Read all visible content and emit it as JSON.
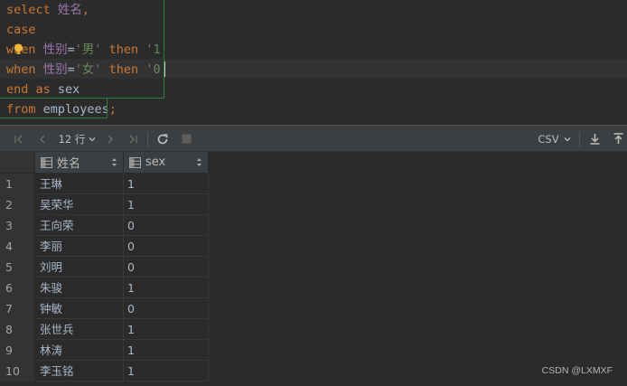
{
  "editor": {
    "lines": [
      [
        {
          "t": "select ",
          "c": "kw"
        },
        {
          "t": "姓名",
          "c": "col"
        },
        {
          "t": ",",
          "c": "kw"
        }
      ],
      [
        {
          "t": "case",
          "c": "kw"
        }
      ],
      [
        {
          "t": "when ",
          "c": "kw"
        },
        {
          "t": "性别",
          "c": "col"
        },
        {
          "t": "=",
          "c": "plain"
        },
        {
          "t": "'男'",
          "c": "str"
        },
        {
          "t": " then ",
          "c": "kw"
        },
        {
          "t": "'1'",
          "c": "str"
        }
      ],
      [
        {
          "t": "when ",
          "c": "kw"
        },
        {
          "t": "性别",
          "c": "col"
        },
        {
          "t": "=",
          "c": "plain"
        },
        {
          "t": "'女'",
          "c": "str"
        },
        {
          "t": " then ",
          "c": "kw"
        },
        {
          "t": "'0'",
          "c": "str"
        }
      ],
      [
        {
          "t": "end as ",
          "c": "kw"
        },
        {
          "t": "sex",
          "c": "plain"
        }
      ],
      [
        {
          "t": "from ",
          "c": "kw"
        },
        {
          "t": "employees",
          "c": "plain"
        },
        {
          "t": ";",
          "c": "kw"
        }
      ]
    ]
  },
  "toolbar": {
    "row_count": "12 行",
    "format": "CSV"
  },
  "grid": {
    "columns": [
      "姓名",
      "sex"
    ],
    "rows": [
      {
        "n": "1",
        "name": "王琳",
        "sex": "1"
      },
      {
        "n": "2",
        "name": "吴荣华",
        "sex": "1"
      },
      {
        "n": "3",
        "name": "王向荣",
        "sex": "0"
      },
      {
        "n": "4",
        "name": "李丽",
        "sex": "0"
      },
      {
        "n": "5",
        "name": "刘明",
        "sex": "0"
      },
      {
        "n": "6",
        "name": "朱骏",
        "sex": "1"
      },
      {
        "n": "7",
        "name": "钟敏",
        "sex": "0"
      },
      {
        "n": "8",
        "name": "张世兵",
        "sex": "1"
      },
      {
        "n": "9",
        "name": "林涛",
        "sex": "1"
      },
      {
        "n": "10",
        "name": "李玉铭",
        "sex": "1"
      }
    ]
  },
  "watermark": "CSDN @LXMXF",
  "colors": {
    "keyword": "#cc7832",
    "column": "#9876aa",
    "string": "#6a8759",
    "text": "#a9b7c6",
    "region_border": "#2e7d3a"
  }
}
